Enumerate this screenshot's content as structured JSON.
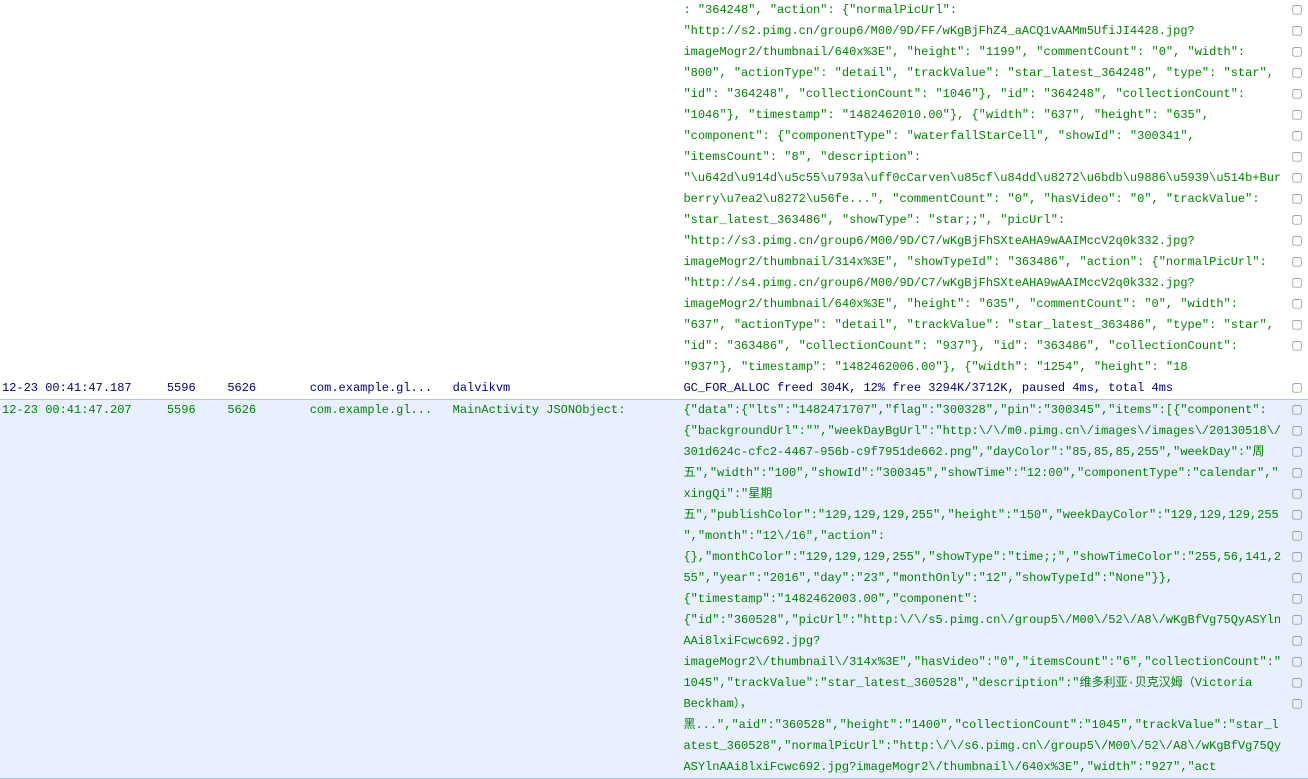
{
  "rows": [
    {
      "time": "",
      "pid": "",
      "tid": "",
      "level": "",
      "pkg": "",
      "tag": "",
      "msg": ": \"364248\", \"action\": {\"normalPicUrl\": \"http://s2.pimg.cn/group6/M00/9D/FF/wKgBjFhZ4_aACQ1vAAMm5UfiJI4428.jpg?imageMogr2/thumbnail/640x%3E\", \"height\": \"1199\", \"commentCount\": \"0\", \"width\": \"800\", \"actionType\": \"detail\", \"trackValue\": \"star_latest_364248\", \"type\": \"star\", \"id\": \"364248\", \"collectionCount\": \"1046\"}, \"id\": \"364248\", \"collectionCount\": \"1046\"}, \"timestamp\": \"1482462010.00\"}, {\"width\": \"637\", \"height\": \"635\", \"component\": {\"componentType\": \"waterfallStarCell\", \"showId\": \"300341\", \"itemsCount\": \"8\", \"description\": \"\\u642d\\u914d\\u5c55\\u793a\\uff0cCarven\\u85cf\\u84dd\\u8272\\u6bdb\\u9886\\u5939\\u514b+Burberry\\u7ea2\\u8272\\u56fe...\", \"commentCount\": \"0\", \"hasVideo\": \"0\", \"trackValue\": \"star_latest_363486\", \"showType\": \"star;;\", \"picUrl\": \"http://s3.pimg.cn/group6/M00/9D/C7/wKgBjFhSXteAHA9wAAIMccV2q0k332.jpg?imageMogr2/thumbnail/314x%3E\", \"showTypeId\": \"363486\", \"action\": {\"normalPicUrl\": \"http://s4.pimg.cn/group6/M00/9D/C7/wKgBjFhSXteAHA9wAAIMccV2q0k332.jpg?imageMogr2/thumbnail/640x%3E\", \"height\": \"635\", \"commentCount\": \"0\", \"width\": \"637\", \"actionType\": \"detail\", \"trackValue\": \"star_latest_363486\", \"type\": \"star\", \"id\": \"363486\", \"collectionCount\": \"937\"}, \"id\": \"363486\", \"collectionCount\": \"937\"}, \"timestamp\": \"1482462006.00\"}, {\"width\": \"1254\", \"height\": \"18",
      "color": "txt-green",
      "bkpts": 17
    },
    {
      "time": "12-23 00:41:47.187",
      "pid": "5596",
      "tid": "5626",
      "level": "",
      "pkg": "com.example.gl...",
      "tag": "dalvikvm",
      "msg": "GC_FOR_ALLOC freed 304K, 12% free 3294K/3712K, paused 4ms, total 4ms",
      "color": "txt-darkblue",
      "bkpts": 1
    },
    {
      "time": "12-23 00:41:47.207",
      "pid": "5596",
      "tid": "5626",
      "level": "",
      "pkg": "com.example.gl...",
      "tag": "MainActivity JSONObject:",
      "msg": "{\"data\":{\"lts\":\"1482471707\",\"flag\":\"300328\",\"pin\":\"300345\",\"items\":[{\"component\":{\"backgroundUrl\":\"\",\"weekDayBgUrl\":\"http:\\/\\/m0.pimg.cn\\/images\\/images\\/20130518\\/301d624c-cfc2-4467-956b-c9f7951de662.png\",\"dayColor\":\"85,85,85,255\",\"weekDay\":\"周五\",\"width\":\"100\",\"showId\":\"300345\",\"showTime\":\"12:00\",\"componentType\":\"calendar\",\"xingQi\":\"星期五\",\"publishColor\":\"129,129,129,255\",\"height\":\"150\",\"weekDayColor\":\"129,129,129,255\",\"month\":\"12\\/16\",\"action\":{},\"monthColor\":\"129,129,129,255\",\"showType\":\"time;;\",\"showTimeColor\":\"255,56,141,255\",\"year\":\"2016\",\"day\":\"23\",\"monthOnly\":\"12\",\"showTypeId\":\"None\"}},{\"timestamp\":\"1482462003.00\",\"component\":{\"id\":\"360528\",\"picUrl\":\"http:\\/\\/s5.pimg.cn\\/group5\\/M00\\/52\\/A8\\/wKgBfVg75QyASYlnAAi8lxiFcwc692.jpg?imageMogr2\\/thumbnail\\/314x%3E\",\"hasVideo\":\"0\",\"itemsCount\":\"6\",\"collectionCount\":\"1045\",\"trackValue\":\"star_latest_360528\",\"description\":\"维多利亚·贝克汉姆（Victoria Beckham），黑...\",\"aid\":\"360528\",\"height\":\"1400\",\"collectionCount\":\"1045\",\"trackValue\":\"star_latest_360528\",\"normalPicUrl\":\"http:\\/\\/s6.pimg.cn\\/group5\\/M00\\/52\\/A8\\/wKgBfVg75QyASYlnAAi8lxiFcwc692.jpg?imageMogr2\\/thumbnail\\/640x%3E\",\"width\":\"927\",\"act",
      "color": "txt-green",
      "selected": true,
      "bkpts": 15
    }
  ],
  "bkpt_glyph": "▢"
}
